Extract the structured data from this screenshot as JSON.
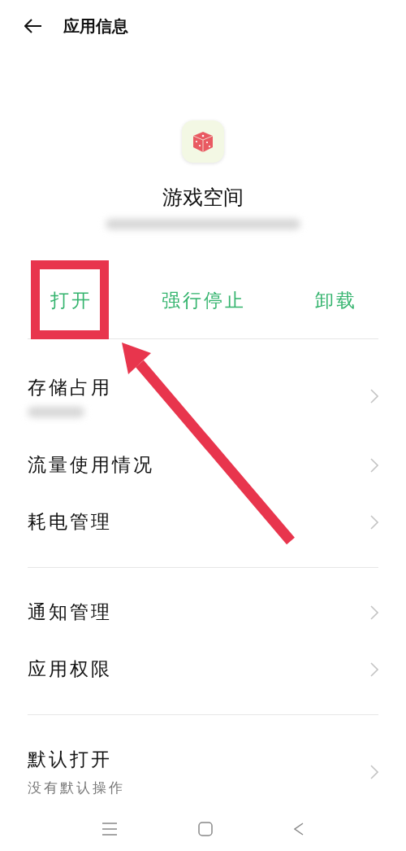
{
  "header": {
    "title": "应用信息"
  },
  "app": {
    "name": "游戏空间",
    "subtitle_redacted": true
  },
  "actions": [
    {
      "label": "打开",
      "highlighted": true
    },
    {
      "label": "强行停止",
      "highlighted": false
    },
    {
      "label": "卸载",
      "highlighted": false
    }
  ],
  "annotation": {
    "arrow": true
  },
  "sections": [
    {
      "items": [
        {
          "label": "存储占用",
          "detail_redacted": true
        },
        {
          "label": "流量使用情况"
        },
        {
          "label": "耗电管理"
        }
      ]
    },
    {
      "items": [
        {
          "label": "通知管理"
        },
        {
          "label": "应用权限"
        }
      ]
    },
    {
      "items": [
        {
          "label": "默认打开",
          "detail": "没有默认操作"
        }
      ]
    }
  ]
}
